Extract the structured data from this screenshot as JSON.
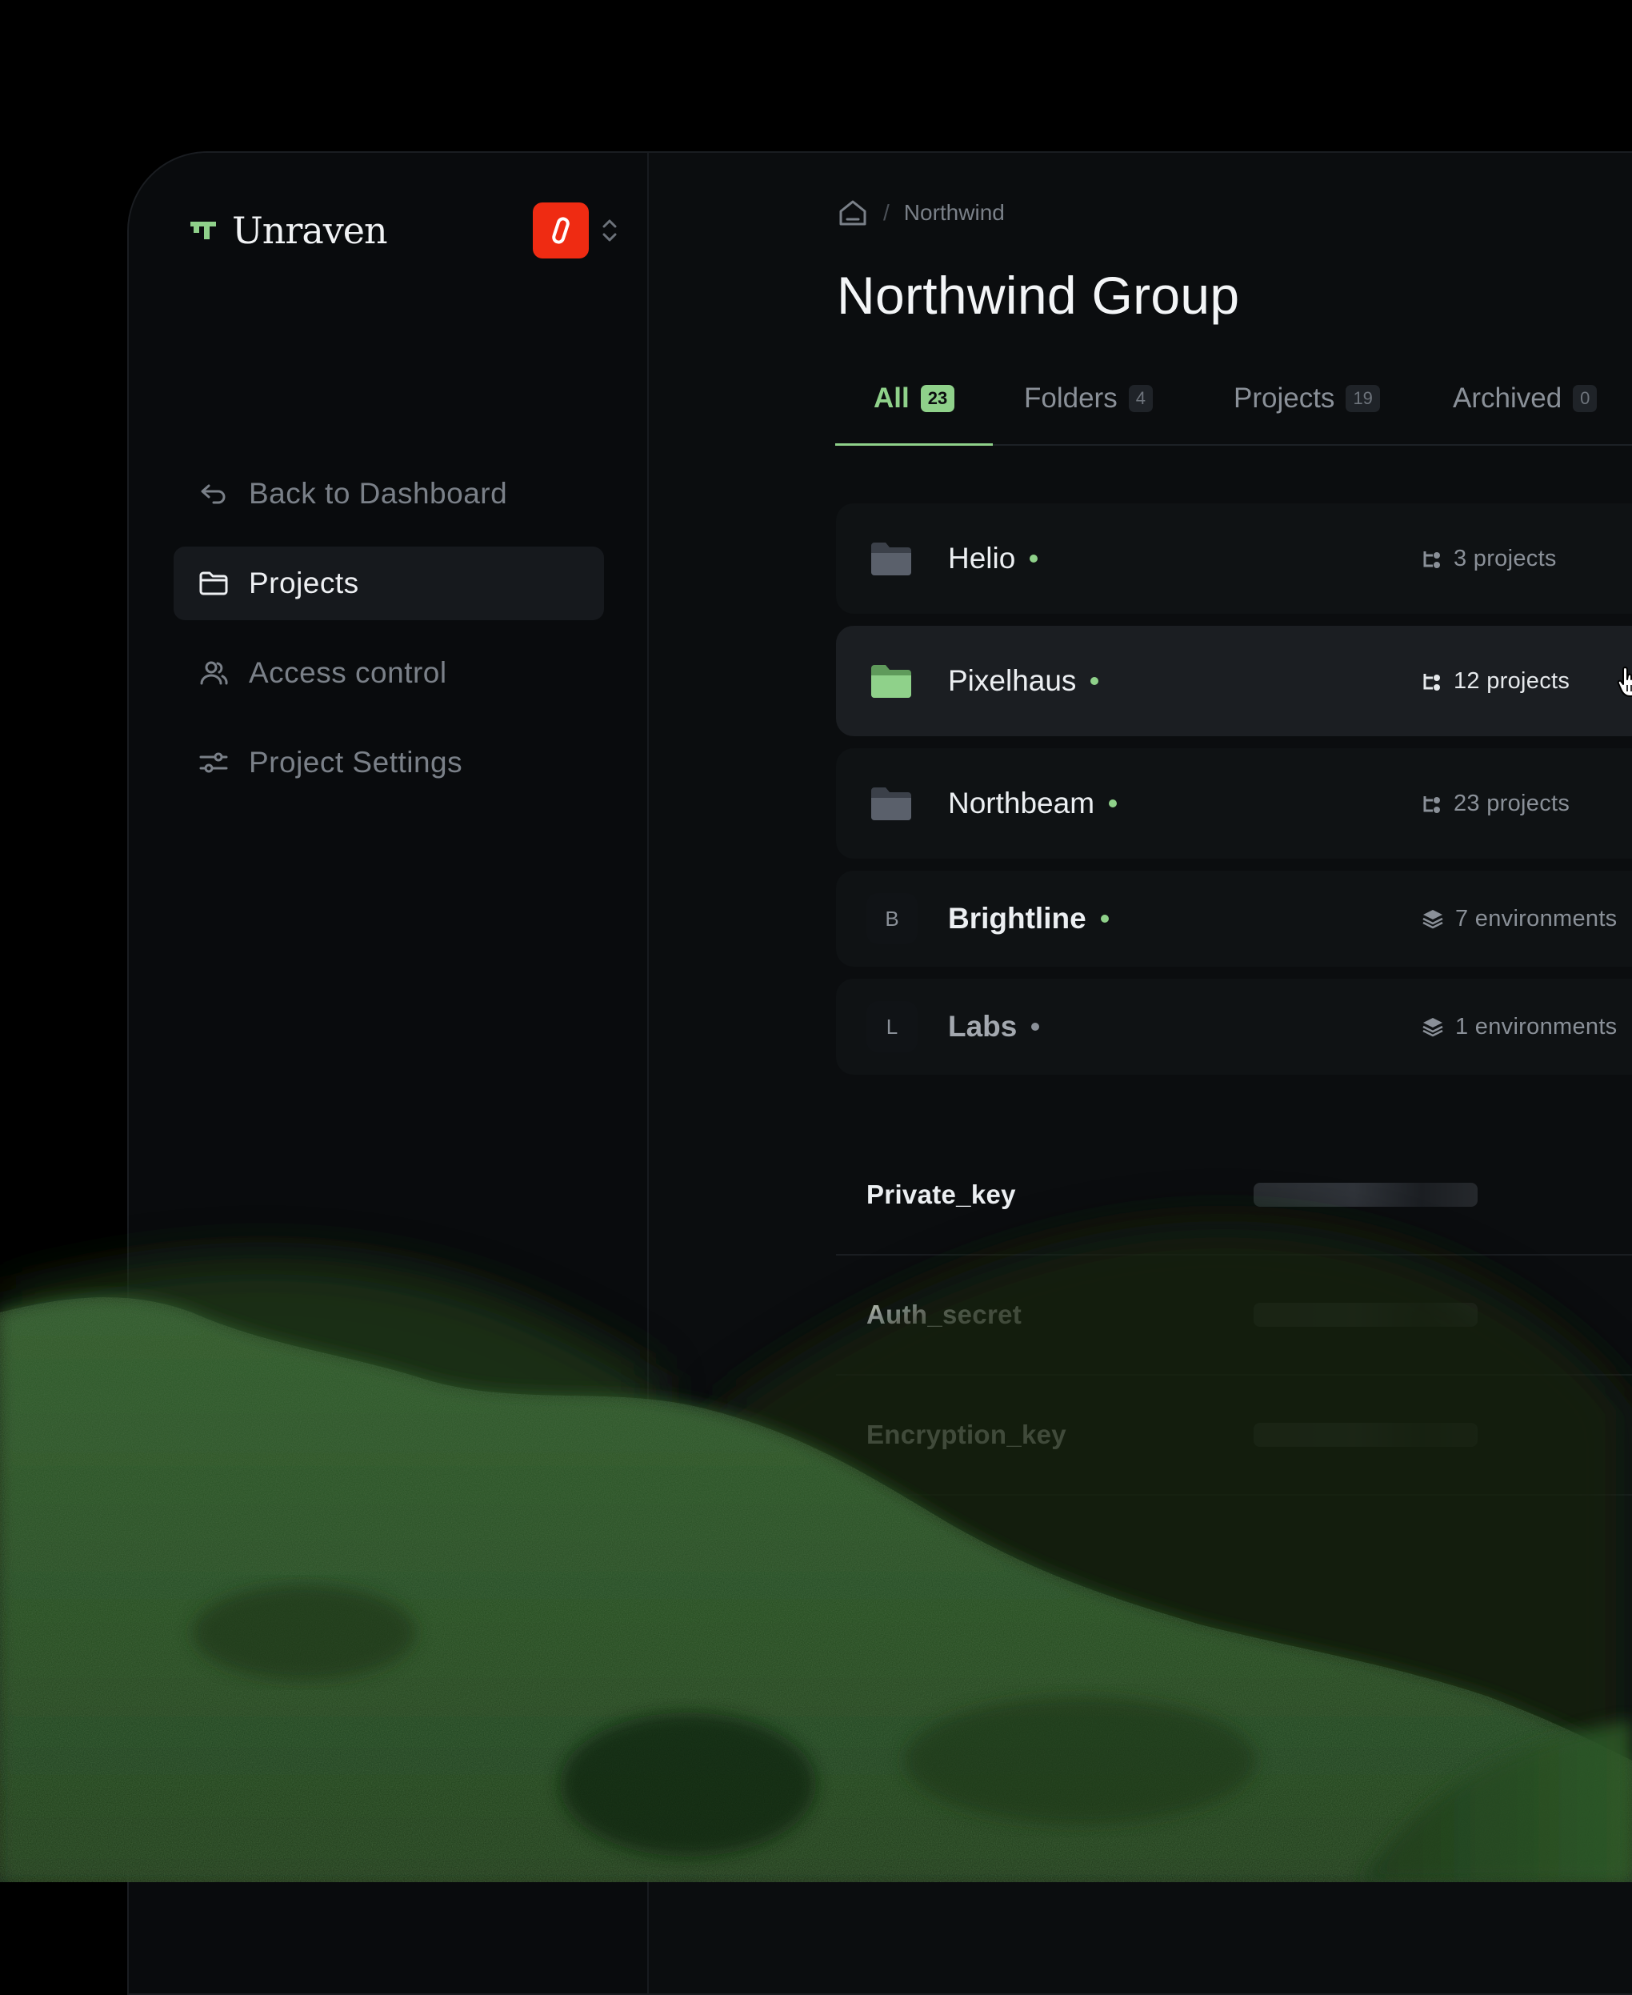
{
  "brand": {
    "name": "Unraven",
    "accent": "#8fd18a",
    "org_badge_color": "#ef2b12",
    "logo_icon": "unraven-logo-icon",
    "org_icon": "link-icon",
    "switch_icon": "chevron-up-down-icon"
  },
  "sidebar": {
    "items": [
      {
        "label": "Back to Dashboard",
        "icon": "back-arrow-icon",
        "active": false
      },
      {
        "label": "Projects",
        "icon": "folder-icon",
        "active": true
      },
      {
        "label": "Access control",
        "icon": "users-icon",
        "active": false
      },
      {
        "label": "Project Settings",
        "icon": "sliders-icon",
        "active": false
      }
    ]
  },
  "breadcrumb": {
    "separator": "/",
    "current": "Northwind",
    "home_icon": "home-icon"
  },
  "page": {
    "title": "Northwind Group"
  },
  "tabs": [
    {
      "label": "All",
      "count": "23",
      "active": true
    },
    {
      "label": "Folders",
      "count": "4",
      "active": false
    },
    {
      "label": "Projects",
      "count": "19",
      "active": false
    },
    {
      "label": "Archived",
      "count": "0",
      "active": false
    }
  ],
  "rows": [
    {
      "name": "Helio",
      "kind": "folder",
      "meta": "3 projects",
      "meta_icon": "hierarchy-icon",
      "status": "active"
    },
    {
      "name": "Pixelhaus",
      "kind": "folder",
      "meta": "12 projects",
      "meta_icon": "hierarchy-icon",
      "status": "active",
      "hovered": true
    },
    {
      "name": "Northbeam",
      "kind": "folder",
      "meta": "23 projects",
      "meta_icon": "hierarchy-icon",
      "status": "active"
    },
    {
      "name": "Brightline",
      "kind": "project",
      "initial": "B",
      "meta": "7 environments",
      "meta_icon": "layers-icon",
      "status": "active"
    },
    {
      "name": "Labs",
      "kind": "project",
      "initial": "L",
      "meta": "1 environments",
      "meta_icon": "layers-icon",
      "status": "inactive"
    }
  ],
  "secrets": [
    {
      "name": "Private_key"
    },
    {
      "name": "Auth_secret"
    },
    {
      "name": "Encryption_key"
    }
  ]
}
